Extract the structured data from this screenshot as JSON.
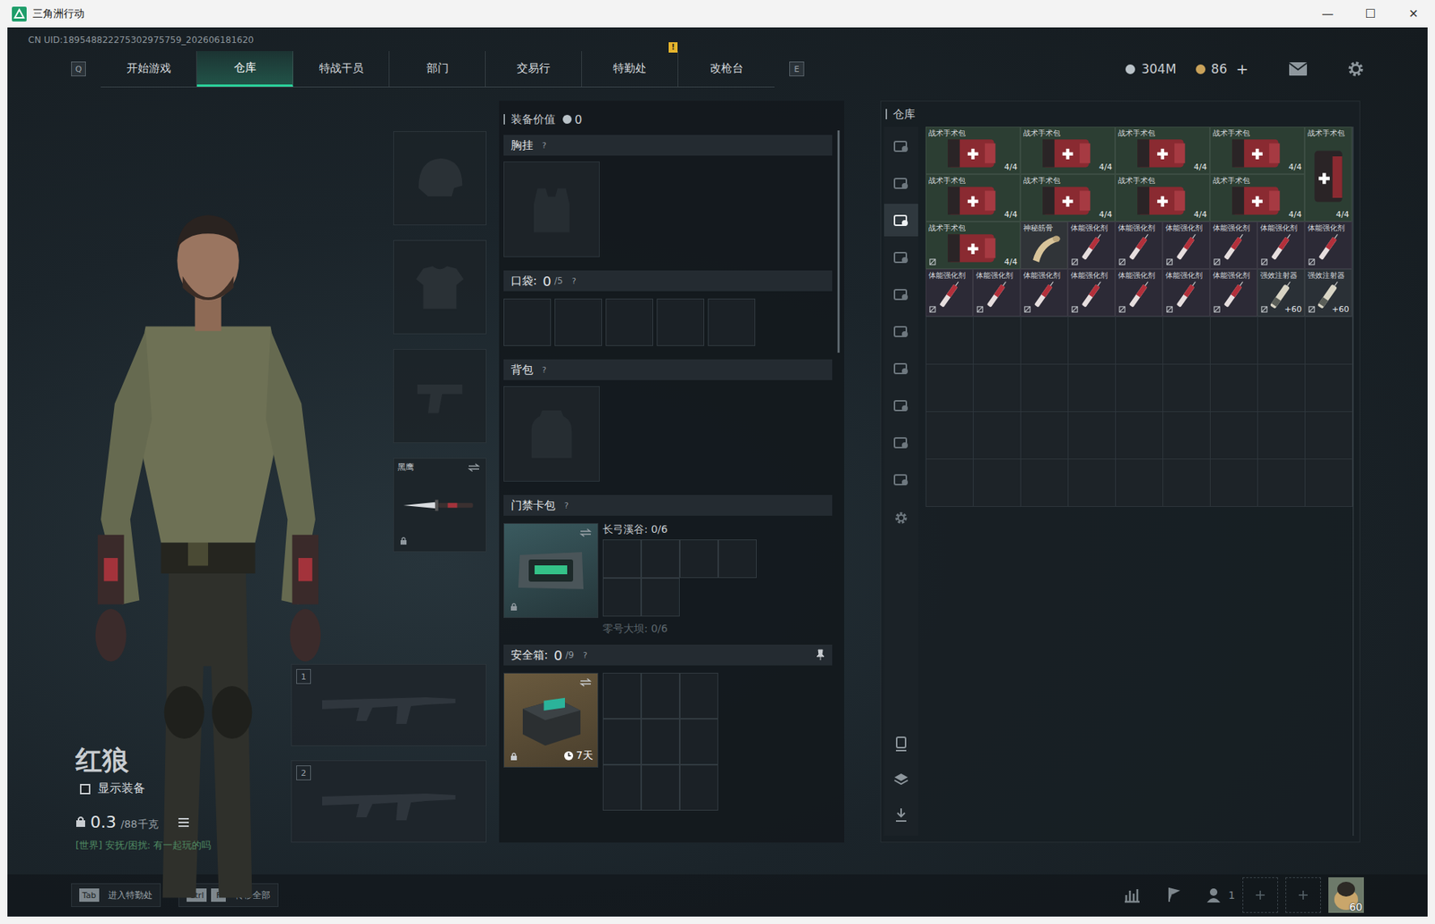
{
  "window": {
    "title": "三角洲行动",
    "controls": [
      "—",
      "☐",
      "✕"
    ]
  },
  "uid": "CN UID:189548822275302975759_202606181620",
  "nav": {
    "left_key": "Q",
    "right_key": "E",
    "alert_mark": "!",
    "tabs": [
      {
        "label": "开始游戏",
        "selected": false,
        "alert": false
      },
      {
        "label": "仓库",
        "selected": true,
        "alert": false
      },
      {
        "label": "特战干员",
        "selected": false,
        "alert": false
      },
      {
        "label": "部门",
        "selected": false,
        "alert": false
      },
      {
        "label": "交易行",
        "selected": false,
        "alert": false
      },
      {
        "label": "特勤处",
        "selected": false,
        "alert": true
      },
      {
        "label": "改枪台",
        "selected": false,
        "alert": false
      }
    ]
  },
  "currency": [
    {
      "value": "304M",
      "color": "#b9c2c8"
    },
    {
      "value": "86",
      "color": "#c9a25a"
    }
  ],
  "currency_add": "+",
  "character": {
    "name": "红狼",
    "show_gear": {
      "label": "显示装备",
      "checked": false
    },
    "weight": "0.3",
    "weight_max": "/88千克",
    "chat": "[世界] 安抚/困扰: 有一起玩的吗"
  },
  "gear_slots": [
    {
      "kind": "helmet",
      "locked": false
    },
    {
      "kind": "armor",
      "locked": false
    },
    {
      "kind": "pistol",
      "locked": false
    },
    {
      "kind": "melee",
      "label": "黑鹰",
      "locked": true
    }
  ],
  "weapon_slots": [
    {
      "number": "1"
    },
    {
      "number": "2"
    }
  ],
  "loadout": {
    "value_label": "装备价值",
    "value": "0",
    "help": "?",
    "chest": {
      "label": "胸挂"
    },
    "pocket": {
      "label": "口袋:",
      "count": "0",
      "max": "/5",
      "slots": 5
    },
    "backpack": {
      "label": "背包"
    },
    "keycard": {
      "label": "门禁卡包",
      "locked": true,
      "maps": [
        {
          "label": "长弓溪谷: 0/6",
          "active": true
        },
        {
          "label": "零号大坝: 0/6",
          "active": false
        }
      ]
    },
    "safebox": {
      "label": "安全箱:",
      "count": "0",
      "max": "/9",
      "timer": "7天",
      "locked": true,
      "pinned": true
    }
  },
  "warehouse": {
    "title": "仓库",
    "side_tabs": [
      {
        "selected": false
      },
      {
        "selected": false
      },
      {
        "selected": true
      },
      {
        "selected": false
      },
      {
        "selected": false
      },
      {
        "selected": false
      },
      {
        "selected": false
      },
      {
        "selected": false
      },
      {
        "selected": false
      },
      {
        "selected": false
      }
    ],
    "items": [
      {
        "name": "战术手术包",
        "count": "4/4",
        "kind": "medkit",
        "color": "#2c3e33",
        "marked": false
      },
      {
        "name": "战术手术包",
        "count": "4/4",
        "kind": "medkit",
        "color": "#2c3e33",
        "marked": false
      },
      {
        "name": "战术手术包",
        "count": "4/4",
        "kind": "medkit",
        "color": "#2c3e33",
        "marked": false
      },
      {
        "name": "战术手术包",
        "count": "4/4",
        "kind": "medkit",
        "color": "#2c3e33",
        "marked": false
      },
      {
        "name": "战术手术包",
        "count": "4/4",
        "kind": "medkit-tall",
        "color": "#2c3e33",
        "marked": false
      },
      {
        "name": "战术手术包",
        "count": "4/4",
        "kind": "medkit",
        "color": "#2c3e33",
        "marked": false
      },
      {
        "name": "战术手术包",
        "count": "4/4",
        "kind": "medkit",
        "color": "#2c3e33",
        "marked": false
      },
      {
        "name": "战术手术包",
        "count": "4/4",
        "kind": "medkit",
        "color": "#2c3e33",
        "marked": false
      },
      {
        "name": "战术手术包",
        "count": "4/4",
        "kind": "medkit",
        "color": "#2c3e33",
        "marked": false
      },
      {
        "name": "战术手术包",
        "count": "4/4",
        "kind": "medkit",
        "color": "#2c3e33",
        "marked": true
      },
      {
        "name": "神秘筋骨",
        "count": "",
        "kind": "bandage",
        "color": "#303438",
        "marked": false
      },
      {
        "name": "体能强化剂",
        "count": "",
        "kind": "stim",
        "color": "#2c2a36",
        "marked": true
      },
      {
        "name": "体能强化剂",
        "count": "",
        "kind": "stim",
        "color": "#2c2a36",
        "marked": true
      },
      {
        "name": "体能强化剂",
        "count": "",
        "kind": "stim",
        "color": "#2c2a36",
        "marked": true
      },
      {
        "name": "体能强化剂",
        "count": "",
        "kind": "stim",
        "color": "#2c2a36",
        "marked": true
      },
      {
        "name": "体能强化剂",
        "count": "",
        "kind": "stim",
        "color": "#2c2a36",
        "marked": true
      },
      {
        "name": "体能强化剂",
        "count": "",
        "kind": "stim",
        "color": "#2c2a36",
        "marked": true
      },
      {
        "name": "体能强化剂",
        "count": "",
        "kind": "stim",
        "color": "#2c2a36",
        "marked": true
      },
      {
        "name": "体能强化剂",
        "count": "",
        "kind": "stim",
        "color": "#2c2a36",
        "marked": true
      },
      {
        "name": "体能强化剂",
        "count": "",
        "kind": "stim",
        "color": "#2c2a36",
        "marked": true
      },
      {
        "name": "体能强化剂",
        "count": "",
        "kind": "stim",
        "color": "#2c2a36",
        "marked": true
      },
      {
        "name": "体能强化剂",
        "count": "",
        "kind": "stim",
        "color": "#2c2a36",
        "marked": true
      },
      {
        "name": "体能强化剂",
        "count": "",
        "kind": "stim",
        "color": "#2c2a36",
        "marked": true
      },
      {
        "name": "体能强化剂",
        "count": "",
        "kind": "stim",
        "color": "#2c2a36",
        "marked": true
      },
      {
        "name": "强效注射器",
        "count": "+60",
        "kind": "injector",
        "color": "#2a3036",
        "marked": true
      },
      {
        "name": "强效注射器",
        "count": "+60",
        "kind": "injector",
        "color": "#2a3036",
        "marked": true
      }
    ]
  },
  "bottom_bar": {
    "hints": [
      {
        "keys": [
          "Tab"
        ],
        "label": "进入特勤处"
      },
      {
        "keys": [
          "Ctrl",
          "F"
        ],
        "label": "转移全部"
      }
    ],
    "squad_count": "1",
    "avatar_level": "60"
  }
}
